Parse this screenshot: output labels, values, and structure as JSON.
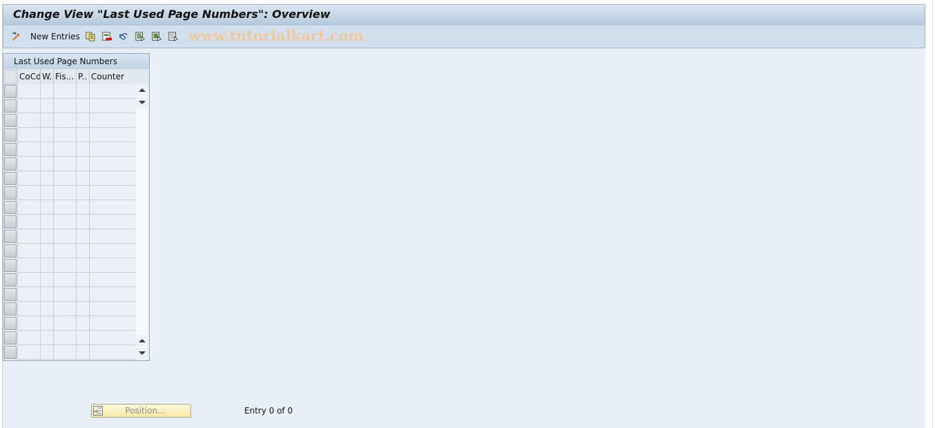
{
  "window": {
    "title": "Change View \"Last Used Page Numbers\": Overview"
  },
  "toolbar": {
    "items": [
      {
        "icon": "display-change-icon",
        "label": ""
      },
      {
        "icon": "new-entries",
        "label": "New Entries"
      },
      {
        "icon": "copy-as-icon",
        "label": ""
      },
      {
        "icon": "delete-icon",
        "label": ""
      },
      {
        "icon": "undo-change-icon",
        "label": ""
      },
      {
        "icon": "select-all-icon",
        "label": ""
      },
      {
        "icon": "select-block-icon",
        "label": ""
      },
      {
        "icon": "deselect-all-icon",
        "label": ""
      }
    ],
    "new_entries_label": "New Entries",
    "watermark": "www.tutorialkart.com"
  },
  "table": {
    "title": "Last Used Page Numbers",
    "columns": [
      "CoCd",
      "W.",
      "Fis...",
      "P..",
      "Counter"
    ],
    "rows": [],
    "visible_empty_rows": 19
  },
  "footer": {
    "position_button_label": "Position...",
    "entry_status": "Entry 0 of 0"
  },
  "colors": {
    "background": "#e9eff6",
    "title_bar": "#c6d6e6",
    "toolbar": "#d2dfec",
    "watermark": "#f0c8a0",
    "position_button": "#f8eeb8"
  }
}
